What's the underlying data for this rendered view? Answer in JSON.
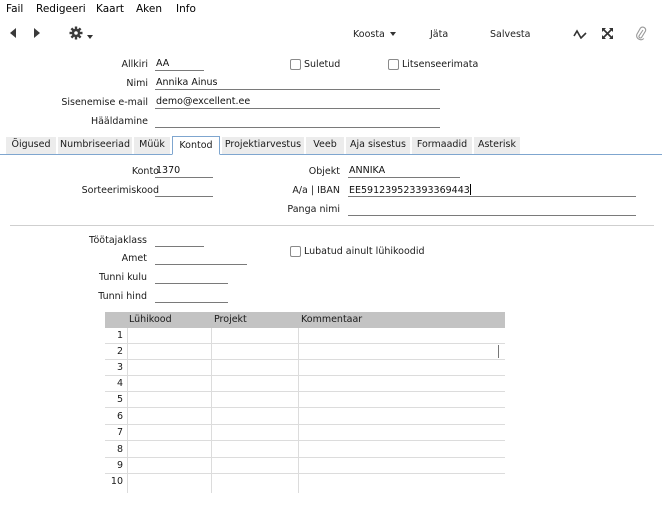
{
  "menu": [
    "Fail",
    "Redigeeri",
    "Kaart",
    "Aken",
    "Info"
  ],
  "toolbar": {
    "create_label": "Koosta",
    "skip_label": "Jäta",
    "save_label": "Salvesta"
  },
  "header_fields": {
    "signature": {
      "label": "Allkiri",
      "value": "AA"
    },
    "name": {
      "label": "Nimi",
      "value": "Annika Ainus"
    },
    "login_email": {
      "label": "Sisenemise e-mail",
      "value": "demo@excellent.ee"
    },
    "voice_login": {
      "label": "Hääldamine",
      "value": ""
    },
    "closed": {
      "label": "Suletud",
      "checked": false
    },
    "license_user": {
      "label": "Litsenseerimata",
      "checked": false
    }
  },
  "tabs": [
    {
      "label": "Õigused",
      "active": false
    },
    {
      "label": "Numbriseeriad",
      "active": false
    },
    {
      "label": "Müük",
      "active": false
    },
    {
      "label": "Kontod",
      "active": true
    },
    {
      "label": "Projektiarvestus",
      "active": false
    },
    {
      "label": "Veeb",
      "active": false
    },
    {
      "label": "Aja sisestus",
      "active": false
    },
    {
      "label": "Formaadid",
      "active": false
    },
    {
      "label": "Asterisk",
      "active": false
    }
  ],
  "accounts": {
    "account": {
      "label": "Konto",
      "value": "1370"
    },
    "sort_code": {
      "label": "Sorteerimiskood",
      "value": ""
    },
    "object": {
      "label": "Objekt",
      "value": "ANNIKA"
    },
    "iban": {
      "label": "A/a | IBAN",
      "value": "EE591239523393369443"
    },
    "bank_name": {
      "label": "Panga nimi",
      "value": ""
    }
  },
  "employee": {
    "class": {
      "label": "Töötajaklass",
      "value": ""
    },
    "job": {
      "label": "Amet",
      "value": ""
    },
    "hour_cost": {
      "label": "Tunni kulu",
      "value": ""
    },
    "hour_price": {
      "label": "Tunni hind",
      "value": ""
    },
    "shortcodes_only": {
      "label": "Lubatud ainult lühikoodid",
      "checked": false
    }
  },
  "grid": {
    "columns": [
      "Lühikood",
      "Projekt",
      "Kommentaar"
    ],
    "rows": [
      "1",
      "2",
      "3",
      "4",
      "5",
      "6",
      "7",
      "8",
      "9",
      "10"
    ]
  }
}
